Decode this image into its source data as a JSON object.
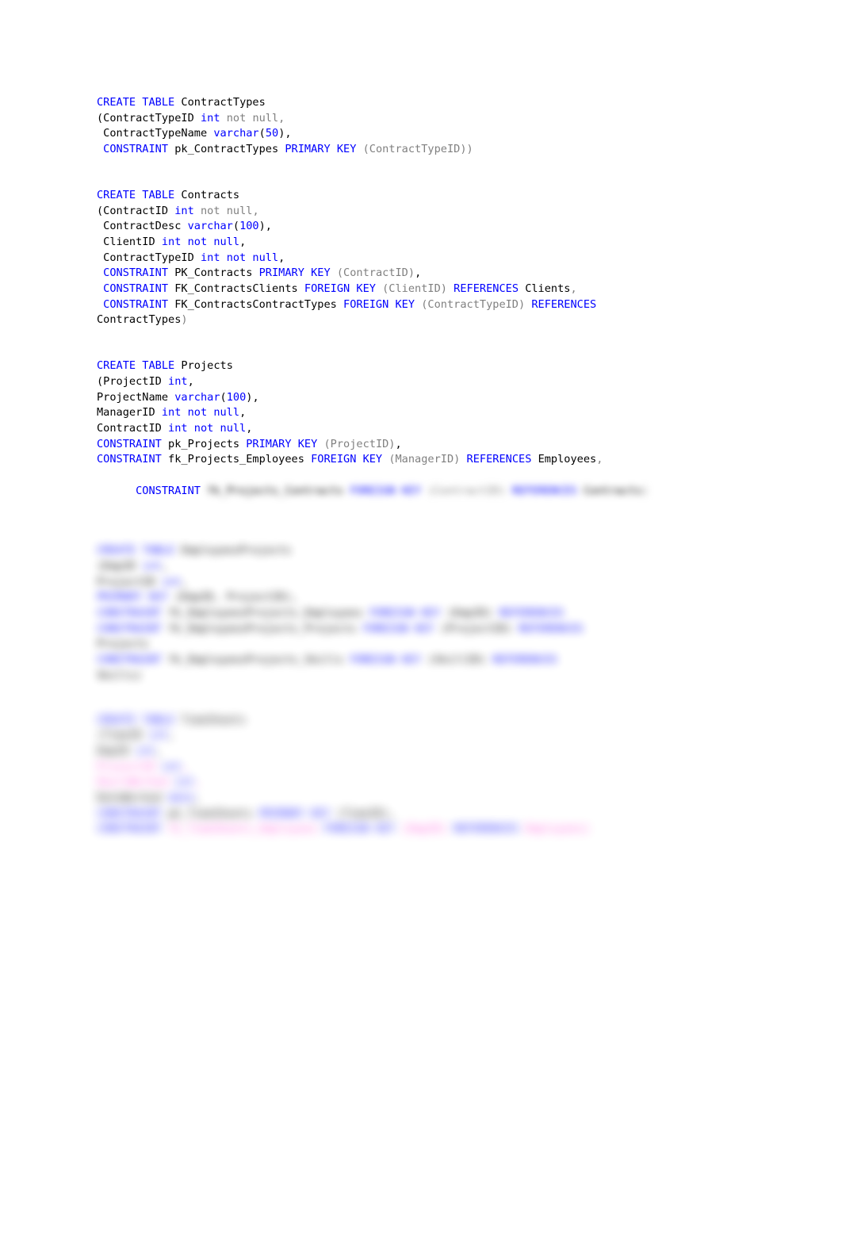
{
  "document": {
    "type": "sql-script",
    "page_background": "#ffffff",
    "text_color": "#000000",
    "keyword_color": "#0000ff",
    "comment_color": "#808080",
    "highlight_color": "#ff55dd",
    "font": "monospace",
    "redaction_note": "lower portion of the page is blurred / illegible"
  },
  "blocks": [
    {
      "id": "create-table-contracttypes",
      "lines": [
        [
          {
            "t": "CREATE TABLE ",
            "c": "kw"
          },
          {
            "t": "ContractTypes",
            "c": "id"
          }
        ],
        [
          {
            "t": "(ContractTypeID ",
            "c": "id"
          },
          {
            "t": "int ",
            "c": "kw"
          },
          {
            "t": "not null,",
            "c": "gray"
          }
        ],
        [
          {
            "t": " ContractTypeName ",
            "c": "id"
          },
          {
            "t": "varchar",
            "c": "kw"
          },
          {
            "t": "(",
            "c": "id"
          },
          {
            "t": "50",
            "c": "kw"
          },
          {
            "t": "),",
            "c": "id"
          }
        ],
        [
          {
            "t": " CONSTRAINT ",
            "c": "kw"
          },
          {
            "t": "pk_ContractTypes ",
            "c": "id"
          },
          {
            "t": "PRIMARY KEY ",
            "c": "kw"
          },
          {
            "t": "(ContractTypeID))",
            "c": "gray"
          }
        ]
      ]
    },
    {
      "id": "create-table-contracts",
      "lines": [
        [
          {
            "t": "CREATE TABLE ",
            "c": "kw"
          },
          {
            "t": "Contracts",
            "c": "id"
          }
        ],
        [
          {
            "t": "(ContractID ",
            "c": "id"
          },
          {
            "t": "int ",
            "c": "kw"
          },
          {
            "t": "not null,",
            "c": "gray"
          }
        ],
        [
          {
            "t": " ContractDesc ",
            "c": "id"
          },
          {
            "t": "varchar",
            "c": "kw"
          },
          {
            "t": "(",
            "c": "id"
          },
          {
            "t": "100",
            "c": "kw"
          },
          {
            "t": "),",
            "c": "id"
          }
        ],
        [
          {
            "t": " ClientID ",
            "c": "id"
          },
          {
            "t": "int not null",
            "c": "kw"
          },
          {
            "t": ",",
            "c": "id"
          }
        ],
        [
          {
            "t": " ContractTypeID ",
            "c": "id"
          },
          {
            "t": "int not null",
            "c": "kw"
          },
          {
            "t": ",",
            "c": "id"
          }
        ],
        [
          {
            "t": " CONSTRAINT ",
            "c": "kw"
          },
          {
            "t": "PK_Contracts ",
            "c": "id"
          },
          {
            "t": "PRIMARY KEY ",
            "c": "kw"
          },
          {
            "t": "(ContractID)",
            "c": "gray"
          },
          {
            "t": ",",
            "c": "id"
          }
        ],
        [
          {
            "t": " CONSTRAINT ",
            "c": "kw"
          },
          {
            "t": "FK_ContractsClients ",
            "c": "id"
          },
          {
            "t": "FOREIGN KEY ",
            "c": "kw"
          },
          {
            "t": "(ClientID) ",
            "c": "gray"
          },
          {
            "t": "REFERENCES ",
            "c": "kw"
          },
          {
            "t": "Clients",
            "c": "id"
          },
          {
            "t": ",",
            "c": "gray"
          }
        ],
        [
          {
            "t": " CONSTRAINT ",
            "c": "kw"
          },
          {
            "t": "FK_ContractsContractTypes ",
            "c": "id"
          },
          {
            "t": "FOREIGN KEY ",
            "c": "kw"
          },
          {
            "t": "(ContractTypeID) ",
            "c": "gray"
          },
          {
            "t": "REFERENCES",
            "c": "kw"
          }
        ],
        [
          {
            "t": "ContractTypes",
            "c": "id"
          },
          {
            "t": ")",
            "c": "gray"
          }
        ]
      ]
    },
    {
      "id": "create-table-projects",
      "lines": [
        [
          {
            "t": "CREATE TABLE ",
            "c": "kw"
          },
          {
            "t": "Projects",
            "c": "id"
          }
        ],
        [
          {
            "t": "(ProjectID ",
            "c": "id"
          },
          {
            "t": "int",
            "c": "kw"
          },
          {
            "t": ",",
            "c": "id"
          }
        ],
        [
          {
            "t": "ProjectName ",
            "c": "id"
          },
          {
            "t": "varchar",
            "c": "kw"
          },
          {
            "t": "(",
            "c": "id"
          },
          {
            "t": "100",
            "c": "kw"
          },
          {
            "t": "),",
            "c": "id"
          }
        ],
        [
          {
            "t": "ManagerID ",
            "c": "id"
          },
          {
            "t": "int not null",
            "c": "kw"
          },
          {
            "t": ",",
            "c": "id"
          }
        ],
        [
          {
            "t": "ContractID ",
            "c": "id"
          },
          {
            "t": "int not null",
            "c": "kw"
          },
          {
            "t": ",",
            "c": "id"
          }
        ],
        [
          {
            "t": "CONSTRAINT ",
            "c": "kw"
          },
          {
            "t": "pk_Projects ",
            "c": "id"
          },
          {
            "t": "PRIMARY KEY ",
            "c": "kw"
          },
          {
            "t": "(ProjectID)",
            "c": "gray"
          },
          {
            "t": ",",
            "c": "id"
          }
        ],
        [
          {
            "t": "CONSTRAINT ",
            "c": "kw"
          },
          {
            "t": "fk_Projects_Employees ",
            "c": "id"
          },
          {
            "t": "FOREIGN KEY ",
            "c": "kw"
          },
          {
            "t": "(ManagerID) ",
            "c": "gray"
          },
          {
            "t": "REFERENCES ",
            "c": "kw"
          },
          {
            "t": "Employees",
            "c": "id"
          },
          {
            "t": ",",
            "c": "gray"
          }
        ]
      ]
    }
  ],
  "partial_line": {
    "id": "constraint-partially-blurred",
    "visible_prefix": "CONSTRAINT",
    "blurred_remainder": "fk_Projects_Contracts FOREIGN KEY (ContractID) REFERENCES Contracts)"
  },
  "blurred_blocks": [
    {
      "id": "blurred-block-1",
      "lines": [
        "CREATE TABLE EmployeesProjects",
        "(EmpID int,",
        "ProjectID int,",
        "PRIMARY KEY (EmpID, ProjectID),",
        "CONSTRAINT fk_EmployeesProjects_Employees FOREIGN KEY (EmpID) REFERENCES",
        "CONSTRAINT fk_EmployeesProjects_Projects FOREIGN KEY (ProjectID) REFERENCES",
        "Projects",
        "CONSTRAINT fk_EmployeesProjects_Skills FOREIGN KEY (SkillID) REFERENCES",
        "Skills)"
      ]
    },
    {
      "id": "blurred-block-2",
      "lines": [
        "CREATE TABLE TimeSheets",
        "(TimeID int,",
        "EmpID int,",
        "ProjectID int,",
        "HoursWorked int,",
        "DateWorked date,",
        "CONSTRAINT pk_TimeSheets PRIMARY KEY (TimeID),",
        "CONSTRAINT fk_TimeSheets_Employees FOREIGN KEY (EmpID) REFERENCES Employees)"
      ]
    }
  ]
}
